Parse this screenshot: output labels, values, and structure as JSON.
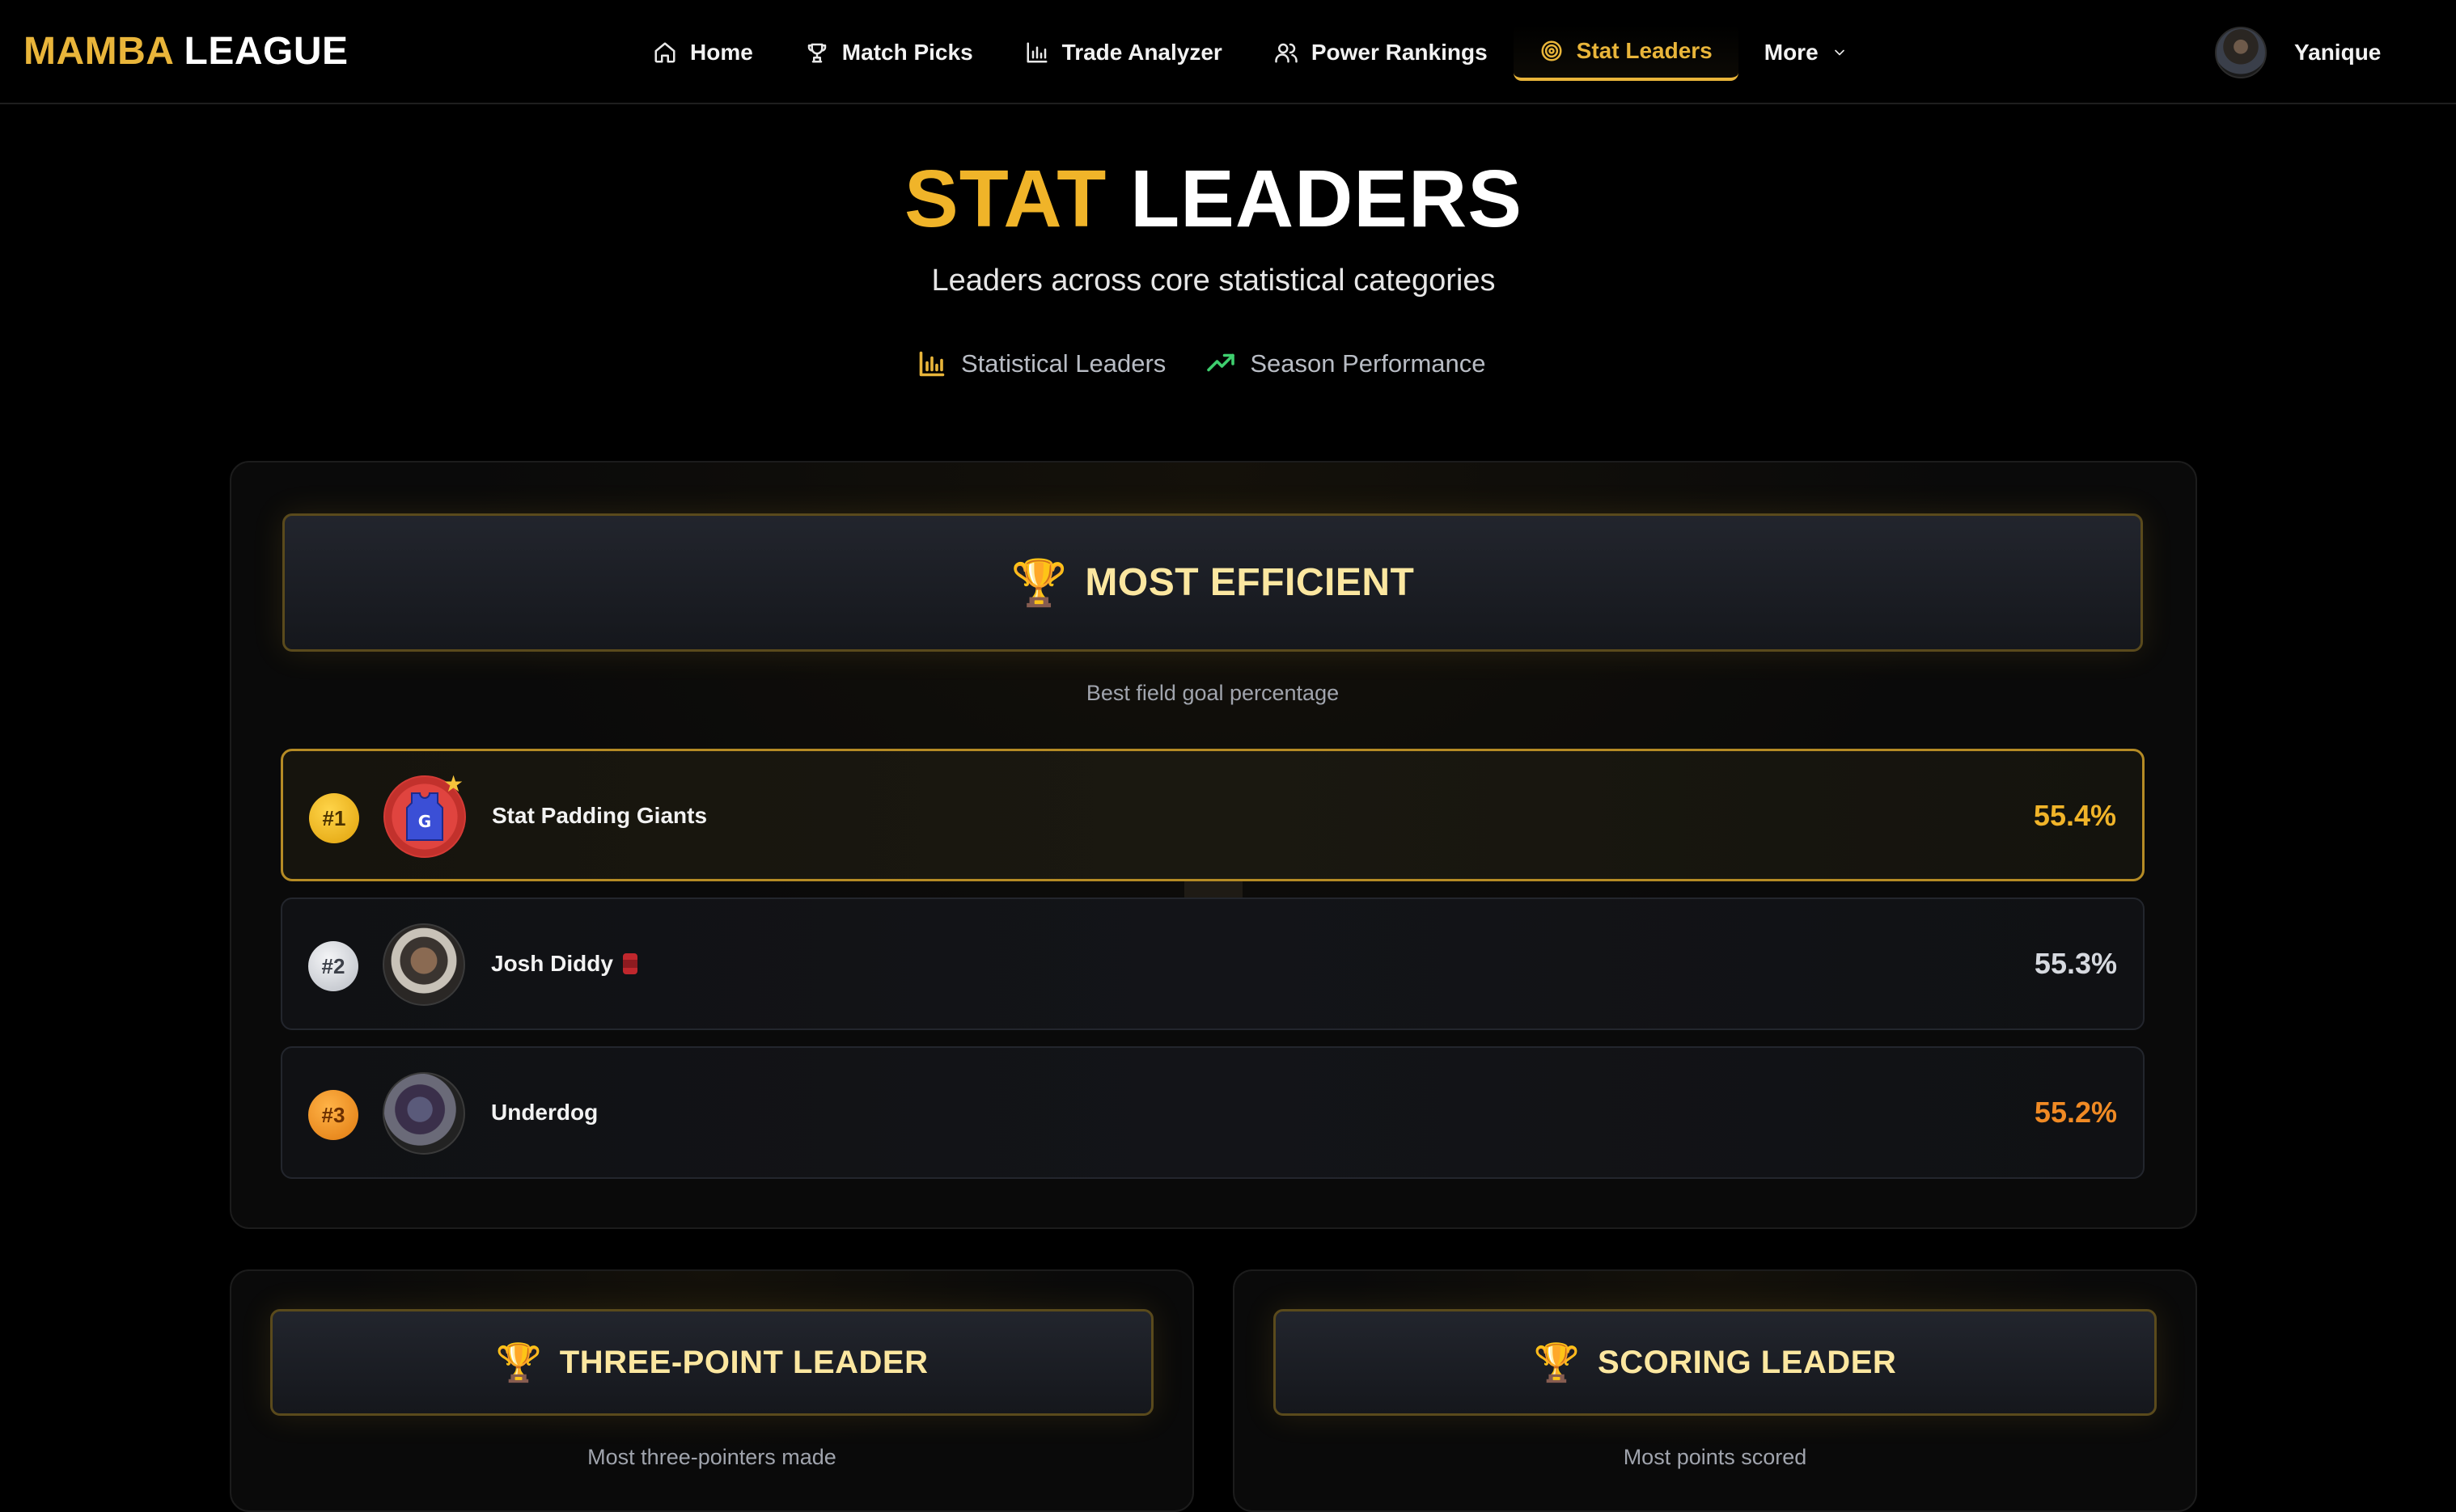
{
  "nav": {
    "brand_part1": "MAMBA",
    "brand_part2": "LEAGUE",
    "items": [
      {
        "label": "Home",
        "icon": "home-icon"
      },
      {
        "label": "Match Picks",
        "icon": "trophy-icon"
      },
      {
        "label": "Trade Analyzer",
        "icon": "bar-chart-icon"
      },
      {
        "label": "Power Rankings",
        "icon": "users-icon"
      },
      {
        "label": "Stat Leaders",
        "icon": "target-icon",
        "active": true
      },
      {
        "label": "More",
        "icon": "chevron-down-icon"
      }
    ],
    "user_name": "Yanique"
  },
  "hero": {
    "title_part1": "STAT",
    "title_part2": "LEADERS",
    "subtitle": "Leaders across core statistical categories",
    "tag1": "Statistical Leaders",
    "tag2": "Season Performance"
  },
  "most_efficient": {
    "title": "MOST EFFICIENT",
    "description": "Best field goal percentage",
    "leaders": [
      {
        "rank": "#1",
        "name": "Stat Padding Giants",
        "value": "55.4%"
      },
      {
        "rank": "#2",
        "name": "Josh Diddy",
        "value": "55.3%"
      },
      {
        "rank": "#3",
        "name": "Underdog",
        "value": "55.2%"
      }
    ]
  },
  "three_point": {
    "title": "THREE-POINT LEADER",
    "description": "Most three-pointers made"
  },
  "scoring": {
    "title": "SCORING LEADER",
    "description": "Most points scored"
  },
  "colors": {
    "accent": "#e9b53a",
    "gold": "#f0b429",
    "silver": "#d6d9df",
    "bronze": "#f08a24",
    "trend_green": "#3ecf6e"
  }
}
